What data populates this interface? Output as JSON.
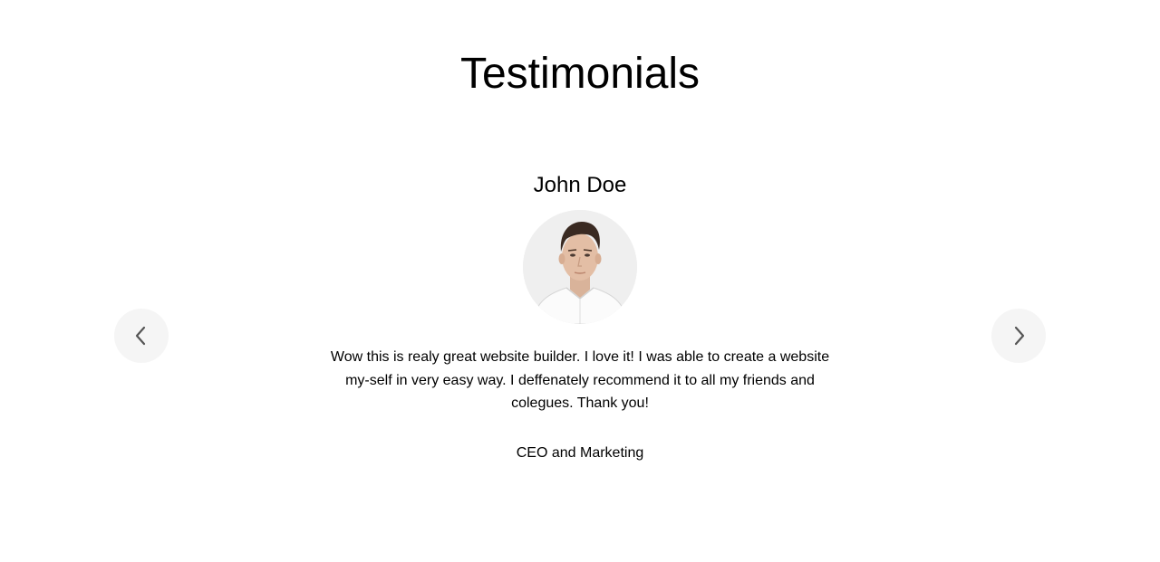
{
  "section": {
    "title": "Testimonials"
  },
  "testimonial": {
    "name": "John Doe",
    "avatar_alt": "portrait of a man in a white shirt",
    "quote": "Wow this is realy great website builder. I love it! I was able to create a website my-self in very easy way. I deffenately recommend it to all my friends and colegues. Thank you!",
    "role": "CEO and Marketing"
  },
  "navigation": {
    "prev_icon": "chevron-left-icon",
    "next_icon": "chevron-right-icon",
    "button_bg": "#f5f5f5",
    "icon_color": "#555555"
  },
  "colors": {
    "background": "#ffffff",
    "text": "#000000"
  }
}
